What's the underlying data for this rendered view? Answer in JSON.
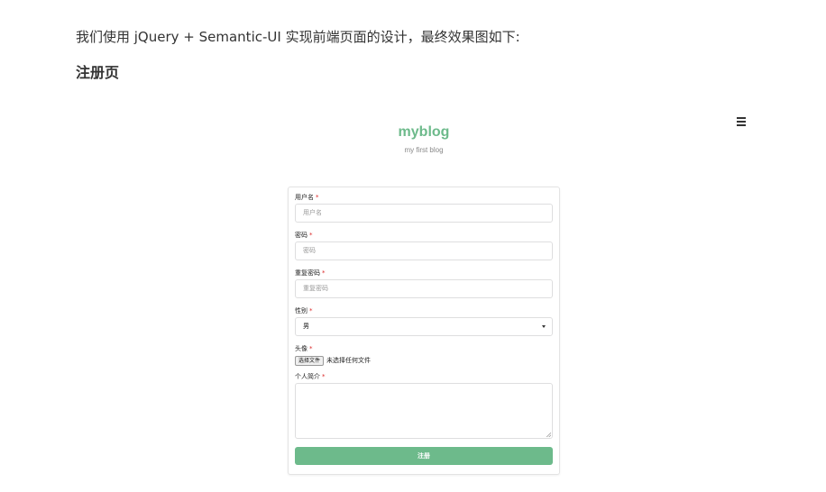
{
  "article": {
    "intro_text": "我们使用 jQuery + Semantic-UI 实现前端页面的设计，最终效果图如下:",
    "section_title": "注册页"
  },
  "app": {
    "brand": "myblog",
    "tagline": "my first blog",
    "menu_icon": "hamburger-menu-icon",
    "accent_color": "#6dba8b"
  },
  "form": {
    "username": {
      "label": "用户名",
      "required_mark": "*",
      "placeholder": "用户名"
    },
    "password": {
      "label": "密码",
      "required_mark": "*",
      "placeholder": "密码"
    },
    "repeat_password": {
      "label": "重复密码",
      "required_mark": "*",
      "placeholder": "重复密码"
    },
    "gender": {
      "label": "性别",
      "required_mark": "*",
      "selected": "男"
    },
    "avatar": {
      "label": "头像",
      "required_mark": "*",
      "button_label": "选择文件",
      "file_status": "未选择任何文件"
    },
    "bio": {
      "label": "个人简介",
      "required_mark": "*"
    },
    "submit_label": "注册"
  }
}
